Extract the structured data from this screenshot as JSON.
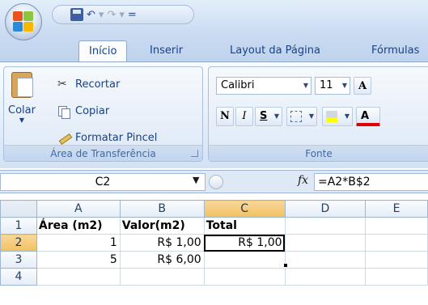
{
  "quick_access": {
    "icons": [
      "save-icon",
      "undo-icon",
      "redo-icon",
      "customize-icon"
    ],
    "separator": "▾",
    "undo_glyph": "↶",
    "redo_glyph": "↷",
    "customize_glyph": "="
  },
  "tabs": [
    {
      "label": "Início",
      "active": true
    },
    {
      "label": "Inserir",
      "active": false
    },
    {
      "label": "Layout da Página",
      "active": false
    },
    {
      "label": "Fórmulas",
      "active": false
    }
  ],
  "clipboard_group": {
    "paste_label": "Colar",
    "cut_label": "Recortar",
    "copy_label": "Copiar",
    "format_painter_label": "Formatar Pincel",
    "group_label": "Área de Transferência"
  },
  "font_group": {
    "font_name": "Calibri",
    "font_size": "11",
    "bold": "N",
    "italic": "I",
    "underline": "S",
    "grow_font": "A",
    "font_color_letter": "A",
    "group_label": "Fonte"
  },
  "formula_bar": {
    "name_box": "C2",
    "fx": "fx",
    "formula": "=A2*B$2"
  },
  "sheet": {
    "columns": [
      "A",
      "B",
      "C",
      "D",
      "E"
    ],
    "rows": [
      {
        "num": "1",
        "cells": [
          "Área (m2)",
          "Valor(m2)",
          "Total",
          "",
          ""
        ]
      },
      {
        "num": "2",
        "cells": [
          "1",
          "R$ 1,00",
          "R$ 1,00",
          "",
          ""
        ]
      },
      {
        "num": "3",
        "cells": [
          "5",
          "R$ 6,00",
          "",
          "",
          ""
        ]
      },
      {
        "num": "4",
        "cells": [
          "",
          "",
          "",
          "",
          ""
        ]
      }
    ],
    "active_cell": "C2"
  }
}
